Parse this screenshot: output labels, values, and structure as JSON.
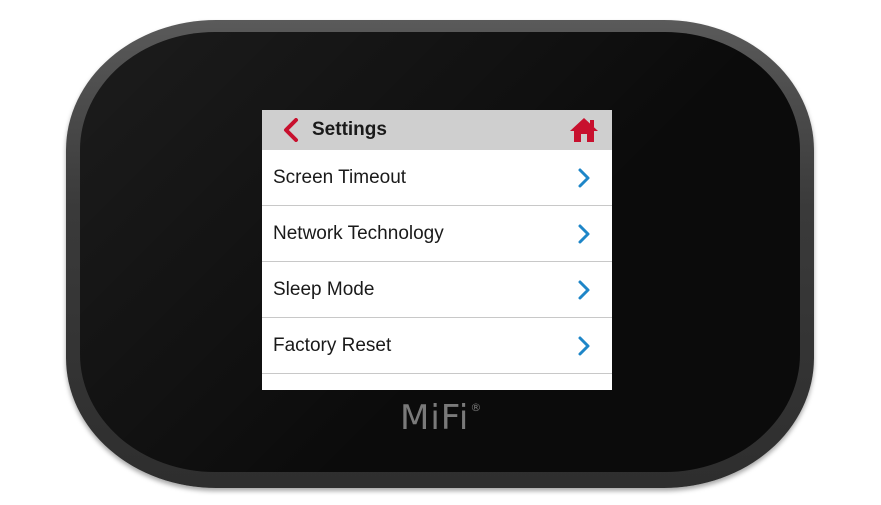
{
  "device": {
    "brand": "MiFi",
    "brand_mark": "®"
  },
  "header": {
    "title": "Settings",
    "back_icon": "chevron-left-icon",
    "home_icon": "home-icon"
  },
  "menu": {
    "items": [
      {
        "label": "Screen Timeout"
      },
      {
        "label": "Network Technology"
      },
      {
        "label": "Sleep Mode"
      },
      {
        "label": "Factory Reset"
      },
      {
        "label": ""
      }
    ]
  },
  "colors": {
    "accent_red": "#c8102e",
    "chevron_blue": "#1e86c8",
    "header_bg": "#cfcfcf"
  }
}
